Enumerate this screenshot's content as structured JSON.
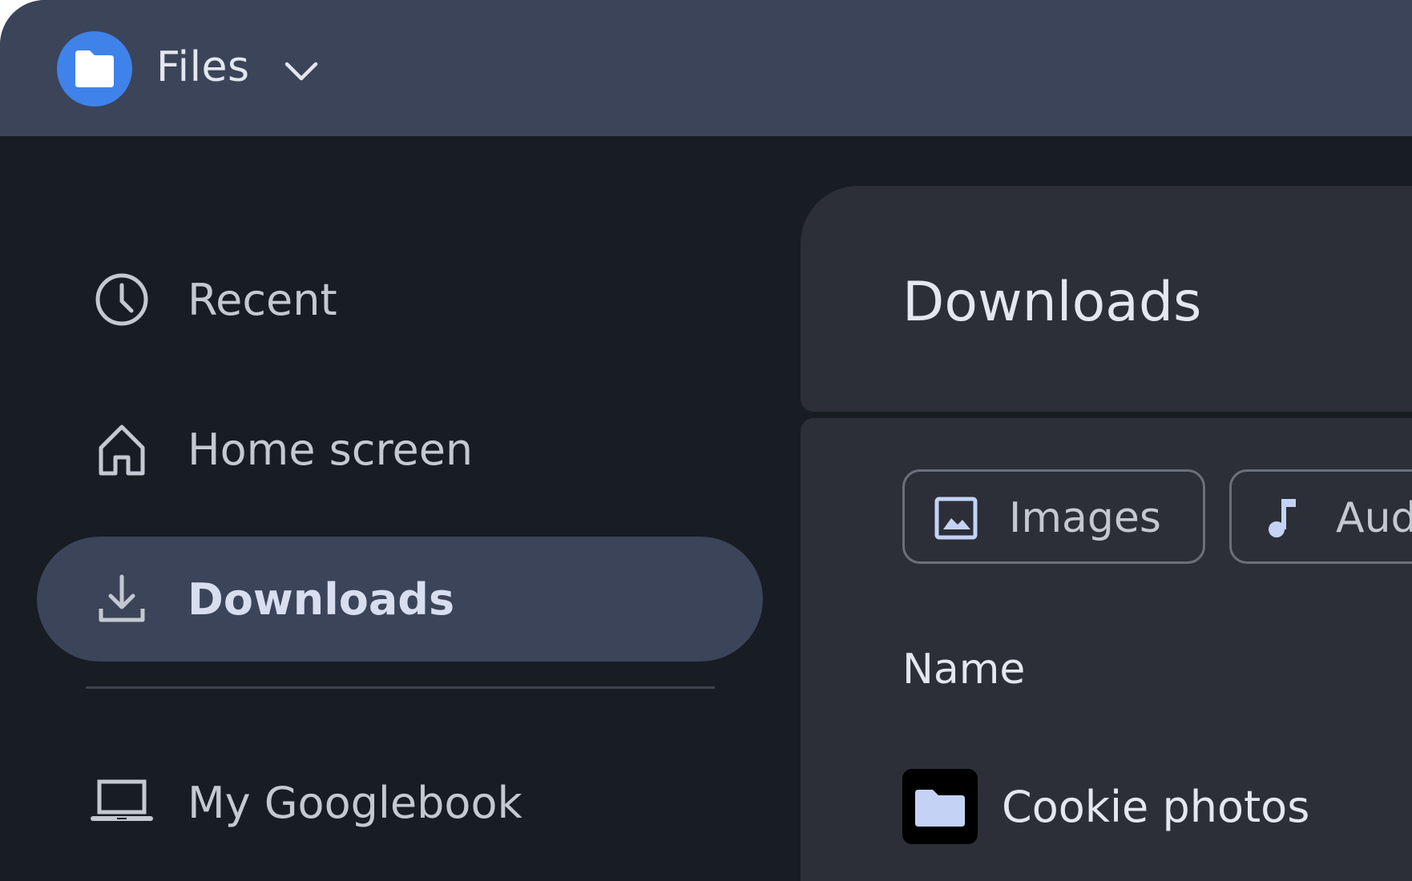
{
  "app": {
    "title": "Files",
    "icon": "folder-icon",
    "brand_color": "#3f82ea"
  },
  "sidebar": {
    "items": [
      {
        "label": "Recent",
        "icon": "clock-icon",
        "active": false
      },
      {
        "label": "Home screen",
        "icon": "home-icon",
        "active": false
      },
      {
        "label": "Downloads",
        "icon": "download-icon",
        "active": true
      },
      {
        "label": "My Googlebook",
        "icon": "laptop-icon",
        "active": false
      }
    ]
  },
  "main": {
    "title": "Downloads",
    "filters": [
      {
        "label": "Images",
        "icon": "image-icon"
      },
      {
        "label": "Audio",
        "icon": "music-note-icon"
      }
    ],
    "columns": {
      "name": "Name"
    },
    "files": [
      {
        "name": "Cookie photos",
        "type": "folder"
      }
    ]
  },
  "colors": {
    "background": "#181c23",
    "titlebar": "#3b4459",
    "panel": "#2c2f37",
    "active_nav": "#3b4459",
    "accent": "#c4d3f5"
  }
}
